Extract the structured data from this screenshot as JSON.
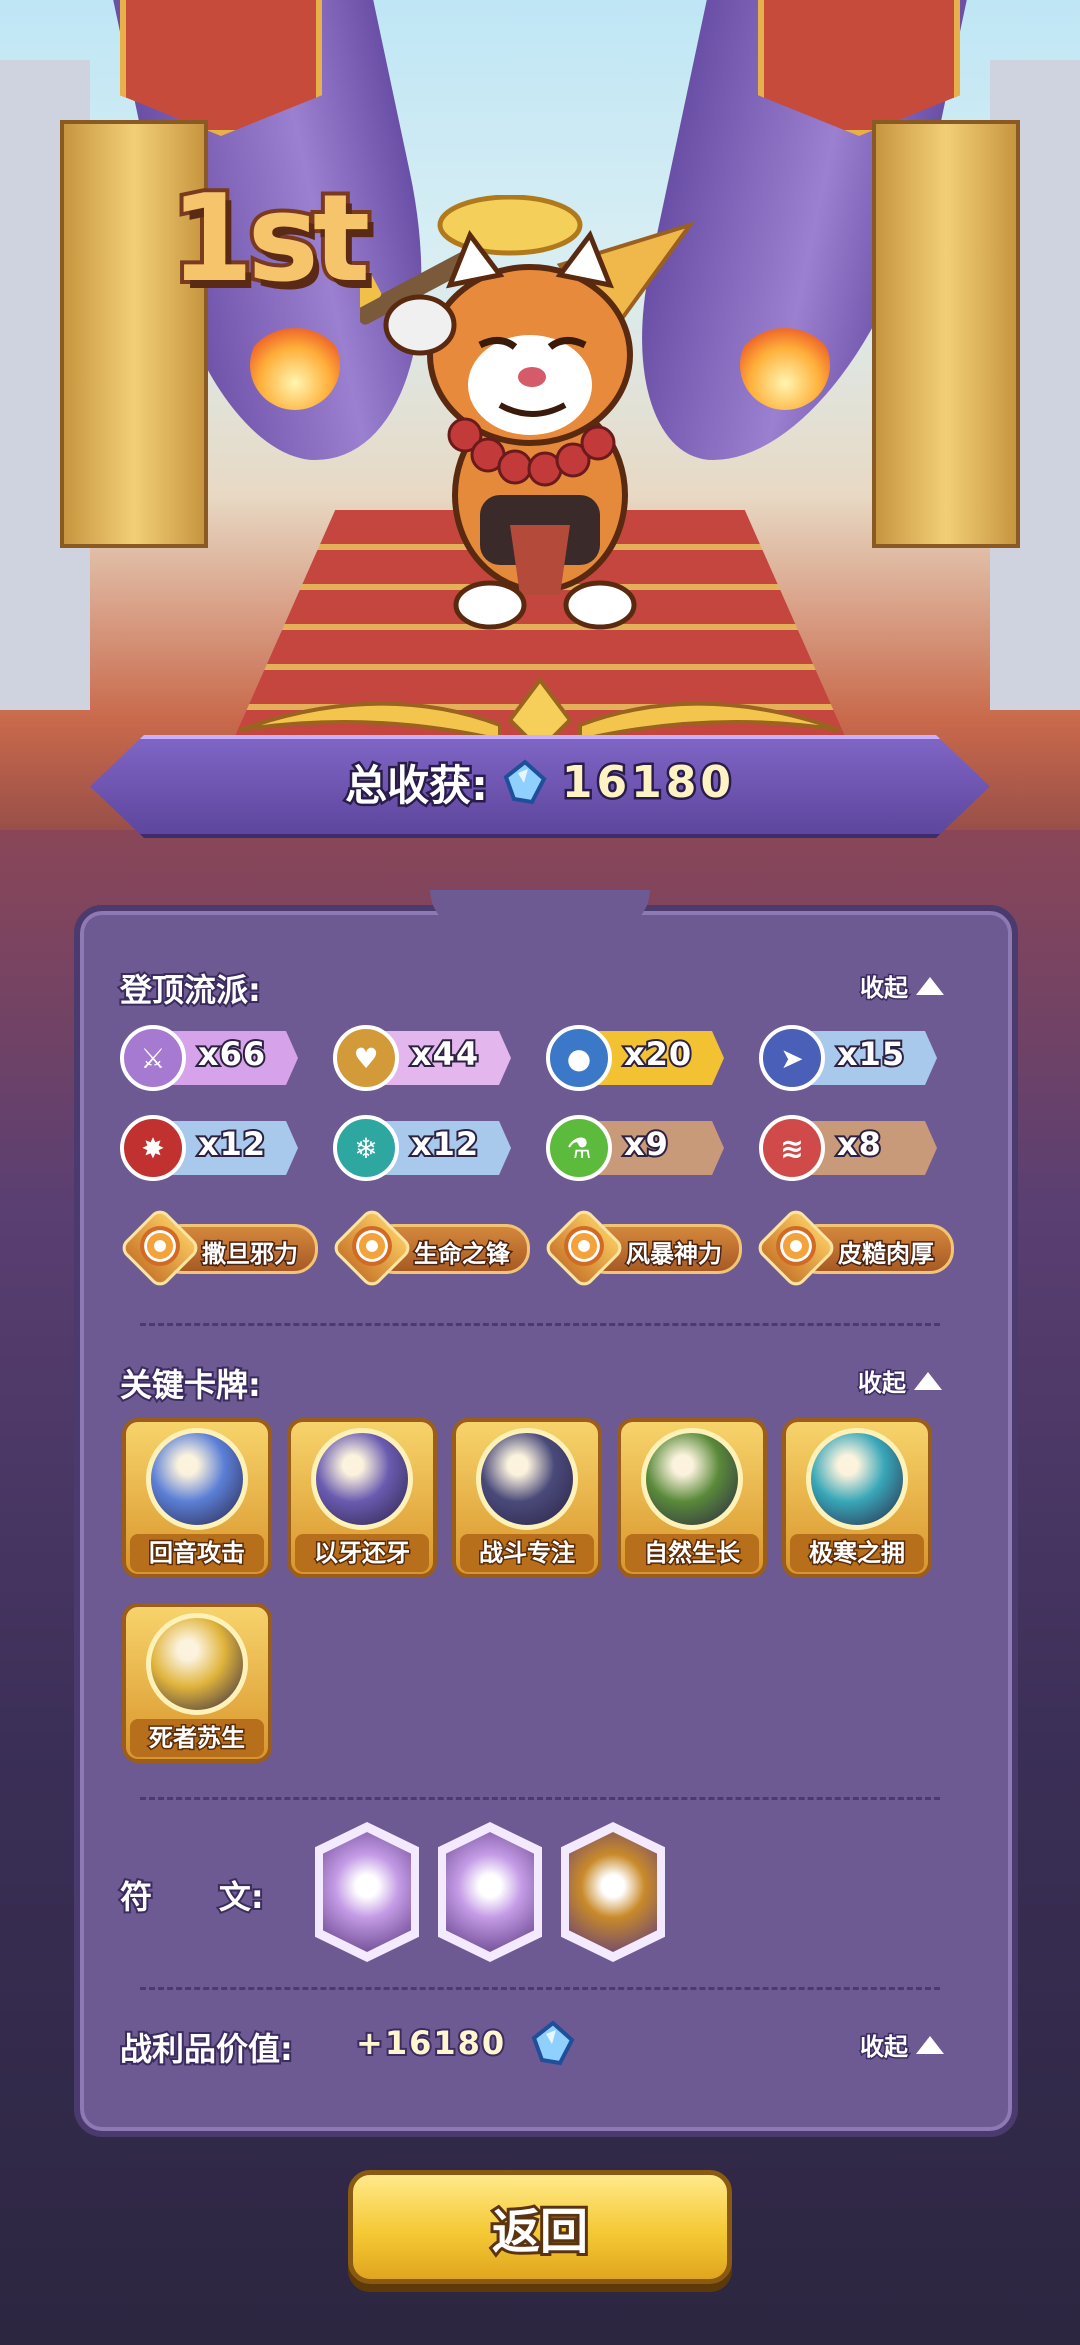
{
  "hero": {
    "rank": "1st"
  },
  "total": {
    "label": "总收获:",
    "value": "16180"
  },
  "schools": {
    "title": "登顶流派:",
    "collapse": "收起",
    "pills": [
      {
        "icon": "sword-icon",
        "count": "x66",
        "color": "#d6a3ea",
        "ring": "#a67ad0"
      },
      {
        "icon": "heart-icon",
        "count": "x44",
        "color": "#e4b6ee",
        "ring": "#d39a3a"
      },
      {
        "icon": "water-drop-icon",
        "count": "x20",
        "color": "#f2c232",
        "ring": "#3c78c8"
      },
      {
        "icon": "boot-icon",
        "count": "x15",
        "color": "#a9c9ec",
        "ring": "#4a5fb8"
      },
      {
        "icon": "burst-icon",
        "count": "x12",
        "color": "#a9c9ec",
        "ring": "#c0312f"
      },
      {
        "icon": "snowflake-icon",
        "count": "x12",
        "color": "#a9c9ec",
        "ring": "#2fa7a1"
      },
      {
        "icon": "potion-icon",
        "count": "x9",
        "color": "#c99a7a",
        "ring": "#5cbb3c"
      },
      {
        "icon": "claw-icon",
        "count": "x8",
        "color": "#c99a7a",
        "ring": "#d04a4a"
      }
    ],
    "auras": [
      "撒旦邪力",
      "生命之锋",
      "风暴神力",
      "皮糙肉厚"
    ]
  },
  "cards": {
    "title": "关键卡牌:",
    "collapse": "收起",
    "items": [
      {
        "label": "回音攻击",
        "art": "sword-slash-icon",
        "color": "#5b7fd6"
      },
      {
        "label": "以牙还牙",
        "art": "cat-fighter-icon",
        "color": "#6a5bb0"
      },
      {
        "label": "战斗专注",
        "art": "hooded-figure-icon",
        "color": "#4a4a7a"
      },
      {
        "label": "自然生长",
        "art": "vine-icon",
        "color": "#5a8a3a"
      },
      {
        "label": "极寒之拥",
        "art": "frost-emblem-icon",
        "color": "#38a7b8"
      },
      {
        "label": "死者苏生",
        "art": "winged-heart-icon",
        "color": "#e0b43c"
      }
    ]
  },
  "runes": {
    "title": "符      文:",
    "items": [
      {
        "icon": "orb-rune-icon",
        "color": "#c49be6"
      },
      {
        "icon": "heart-scroll-rune-icon",
        "color": "#c49be6"
      },
      {
        "icon": "fist-rune-icon",
        "color": "#c98a2a"
      }
    ]
  },
  "loot": {
    "label": "战利品价值:",
    "value": "+16180",
    "collapse": "收起"
  },
  "button": {
    "label": "返回"
  }
}
